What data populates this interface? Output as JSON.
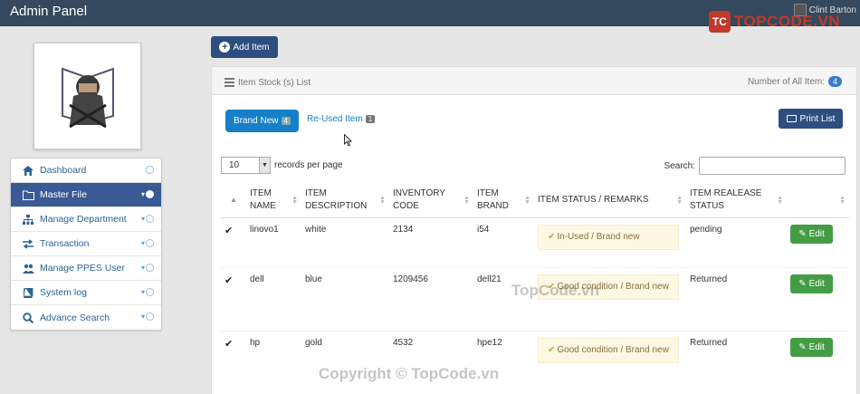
{
  "header": {
    "title": "Admin Panel",
    "user_name": "Clint Barton"
  },
  "watermarks": {
    "logo_text": "TOPCODE.VN",
    "center": "TopCode.vn",
    "bottom": "Copyright © TopCode.vn"
  },
  "sidebar": {
    "items": [
      {
        "label": "Dashboard",
        "icon": "home-icon"
      },
      {
        "label": "Master File",
        "icon": "folder-icon"
      },
      {
        "label": "Manage Department",
        "icon": "sitemap-icon"
      },
      {
        "label": "Transaction",
        "icon": "exchange-icon"
      },
      {
        "label": "Manage PPES User",
        "icon": "users-icon"
      },
      {
        "label": "System log",
        "icon": "book-icon"
      },
      {
        "label": "Advance Search",
        "icon": "search-icon"
      }
    ]
  },
  "toolbar": {
    "add_label": "Add Item"
  },
  "panel": {
    "title": "Item Stock (s) List",
    "count_label": "Number of All Item:",
    "count": "4",
    "tabs": [
      {
        "label": "Brand New",
        "badge": "4"
      },
      {
        "label": "Re-Used Item",
        "badge": "1"
      }
    ],
    "print_label": "Print List",
    "length_value": "10",
    "length_suffix": "records per page",
    "search_label": "Search:"
  },
  "table": {
    "headers": [
      "ITEM NAME",
      "ITEM DESCRIPTION",
      "INVENTORY CODE",
      "ITEM BRAND",
      "ITEM STATUS / REMARKS",
      "ITEM REALEASE STATUS"
    ],
    "rows": [
      {
        "name": "linovo1",
        "description": "white",
        "code": "2134",
        "brand": "i54",
        "status": "In-Used / Brand new",
        "release": "pending",
        "action": "Edit"
      },
      {
        "name": "dell",
        "description": "blue",
        "code": "1209456",
        "brand": "dell21",
        "status": "Good condition / Brand new",
        "release": "Returned",
        "action": "Edit"
      },
      {
        "name": "hp",
        "description": "gold",
        "code": "4532",
        "brand": "hpe12",
        "status": "Good condition / Brand new",
        "release": "Returned",
        "action": "Edit"
      }
    ]
  },
  "colors": {
    "header_bg": "#34495e",
    "active_nav": "#3a5a95",
    "primary": "#1580c8",
    "edit": "#449d44"
  }
}
